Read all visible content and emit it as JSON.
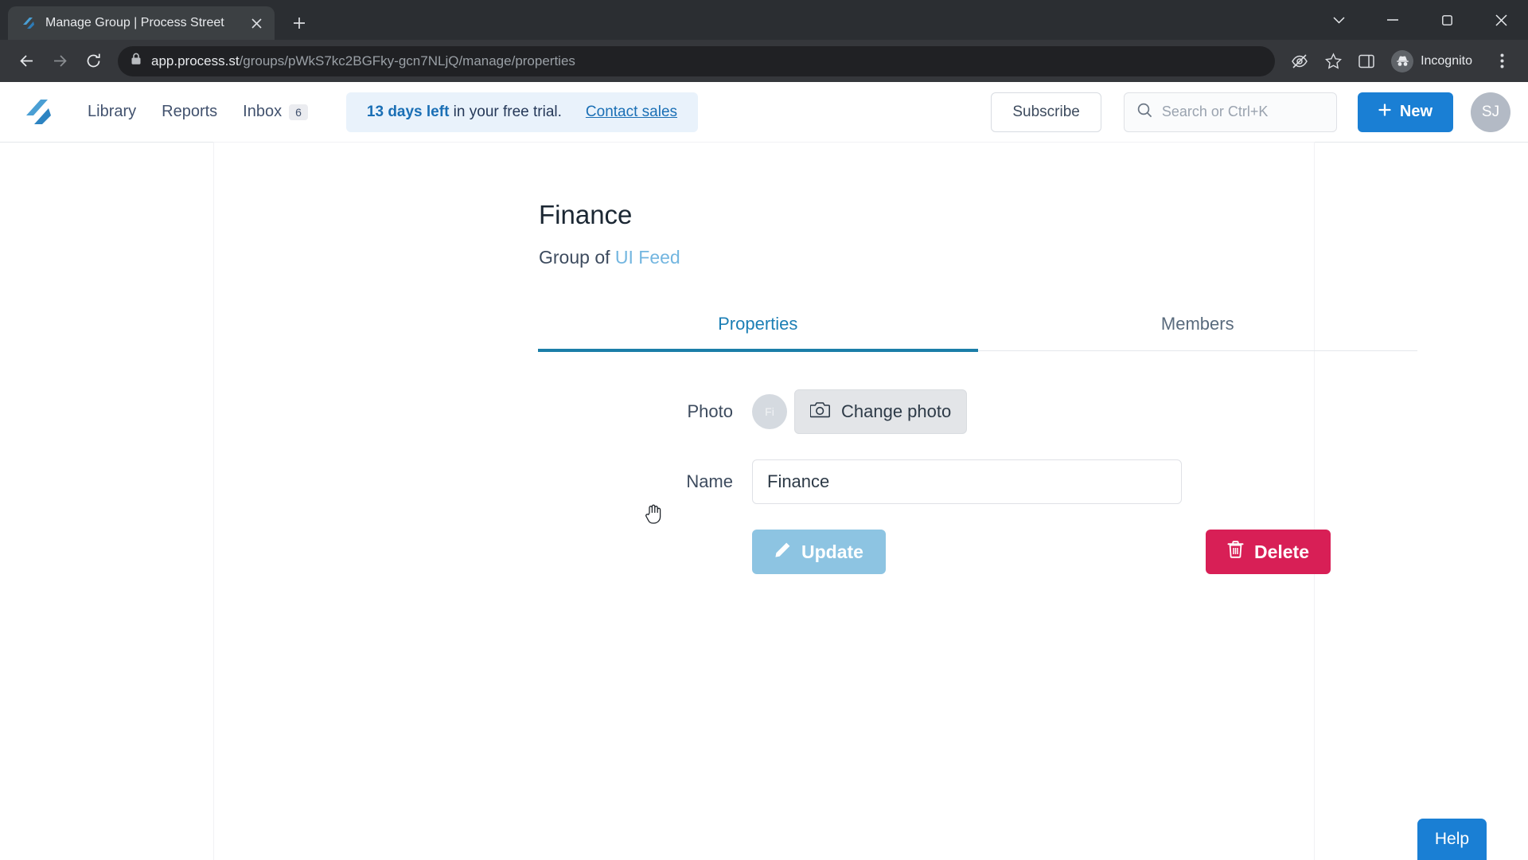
{
  "browser": {
    "tab": {
      "title": "Manage Group | Process Street",
      "favicon_icon": "process-street-logo-icon",
      "close_icon": "close-icon"
    },
    "new_tab_icon": "plus-icon",
    "window_controls": {
      "minimize_all_icon": "chevron-down-icon",
      "minimize_icon": "minimize-icon",
      "maximize_icon": "maximize-icon",
      "close_icon": "close-icon"
    },
    "nav": {
      "back_icon": "back-arrow-icon",
      "forward_icon": "forward-arrow-icon",
      "reload_icon": "reload-icon"
    },
    "url": {
      "lock_icon": "lock-icon",
      "domain": "app.process.st",
      "path": "/groups/pWkS7kc2BGFky-gcn7NLjQ/manage/properties",
      "full": "app.process.st/groups/pWkS7kc2BGFky-gcn7NLjQ/manage/properties"
    },
    "omni_right": {
      "tracking_icon": "eye-crossed-icon",
      "bookmark_icon": "star-icon",
      "sidepanel_icon": "side-panel-icon",
      "incognito_label": "Incognito",
      "incognito_icon": "incognito-hat-icon",
      "menu_icon": "kebab-menu-icon"
    }
  },
  "appbar": {
    "logo_icon": "process-street-logo-icon",
    "nav_items": [
      {
        "label": "Library"
      },
      {
        "label": "Reports"
      }
    ],
    "inbox": {
      "label": "Inbox",
      "badge": "6"
    },
    "trial": {
      "days_bold": "13 days left",
      "rest": " in your free trial.",
      "link": "Contact sales"
    },
    "subscribe_label": "Subscribe",
    "search": {
      "placeholder": "Search or Ctrl+K",
      "icon": "search-icon"
    },
    "new_button": {
      "label": "New",
      "icon": "plus-icon"
    },
    "avatar_initials": "SJ"
  },
  "main": {
    "title": "Finance",
    "subtitle_prefix": "Group of ",
    "subtitle_link": "UI Feed",
    "tabs": [
      {
        "label": "Properties",
        "active": true
      },
      {
        "label": "Members",
        "active": false
      }
    ],
    "form": {
      "photo_label": "Photo",
      "photo_avatar_initials": "Fi",
      "change_photo_label": "Change photo",
      "change_photo_icon": "camera-icon",
      "name_label": "Name",
      "name_value": "Finance",
      "update_label": "Update",
      "update_icon": "pencil-icon",
      "delete_label": "Delete",
      "delete_icon": "trash-icon"
    }
  },
  "help": {
    "label": "Help"
  },
  "colors": {
    "accent_blue": "#1a7fd4",
    "tab_active": "#1b7ea8",
    "danger": "#d81f56",
    "update_disabled": "#8dc4e2",
    "link_light": "#73b6e0",
    "banner_bg": "#e9f2fb"
  }
}
